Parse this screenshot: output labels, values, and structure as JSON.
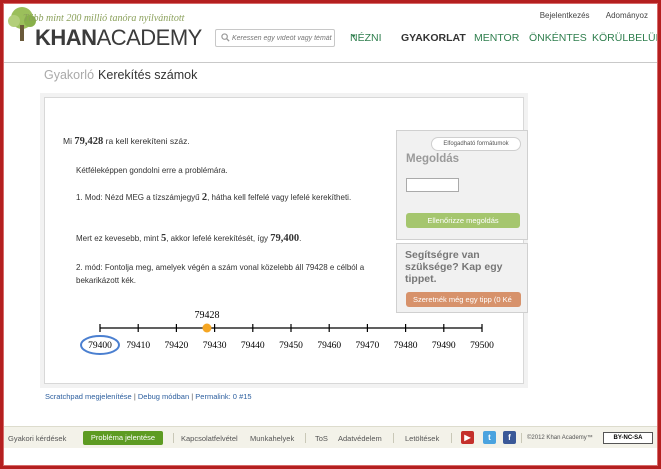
{
  "header": {
    "tagline": "Több mint 200 millió tanóra nyilvánított",
    "logo_part1": "KHAN",
    "logo_part2": "ACADEMY",
    "search_placeholder": "Keressen egy videót vagy témát",
    "top_links": [
      "Bejelentkezés",
      "Adományoz"
    ],
    "nav": [
      {
        "label": "NÉZNI",
        "caret": "▾"
      },
      {
        "label": "GYAKORLAT"
      },
      {
        "label": "MENTOR"
      },
      {
        "label": "ÖNKÉNTES"
      },
      {
        "label": "KÖRÜLBELÜL"
      }
    ]
  },
  "page": {
    "crumb": "Gyakorló",
    "title": "Kerekítés számok"
  },
  "exercise": {
    "question_prefix": "Mi",
    "question_number": "79,428",
    "question_suffix": "ra kell kerekíteni száz.",
    "p1": "Kétféleképpen gondolni erre a problémára.",
    "p2_a": "1. Mod: Nézd MEG a tízszámjegyű",
    "p2_num": "2",
    "p2_b": ", hátha kell felfelé vagy lefelé kerekítheti.",
    "p3_a": "Mert ez kevesebb, mint",
    "p3_num1": "5",
    "p3_b": ", akkor lefelé kerekítését, így",
    "p3_num2": "79,400",
    "p3_c": ".",
    "p4": "2. mód: Fontolja meg, amelyek végén a szám vonal közelebb áll 79428 e célból a bekarikázott kék."
  },
  "number_line": {
    "ticks": [
      "79400",
      "79410",
      "79420",
      "79430",
      "79440",
      "79450",
      "79460",
      "79470",
      "79480",
      "79490",
      "79500"
    ],
    "point_label": "79428",
    "point_value": 79428,
    "min": 79400,
    "max": 79500,
    "circled": "79400",
    "point_color": "#f5a623",
    "circle_color": "#4a7fd0"
  },
  "answer_panel": {
    "format_button": "Elfogadható formátumok",
    "title": "Megoldás",
    "input_value": "",
    "check_button": "Ellenőrizze megoldás"
  },
  "help_panel": {
    "title": "Segítségre van szüksége? Kap egy tippet.",
    "hint_button": "Szeretnék még egy tipp (0 Ké"
  },
  "debug_links": {
    "scratchpad": "Scratchpad megjelenítése",
    "sep": "|",
    "debug": "Debug módban",
    "permalink": "Permalink: 0 #15"
  },
  "footer": {
    "faq": "Gyakori kérdések",
    "report": "Probléma jelentése",
    "contact": "Kapcsolatfelvétel",
    "jobs": "Munkahelyek",
    "tos": "ToS",
    "privacy": "Adatvédelem",
    "downloads": "Letöltések",
    "copyright": "©2012 Khan Academy™",
    "license": "BY-NC-SA"
  }
}
